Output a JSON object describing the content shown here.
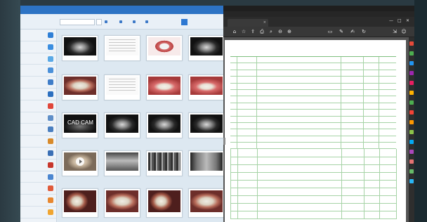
{
  "left_app": {
    "title": "",
    "toolbar": {
      "search_value": "",
      "field2_value": "",
      "buttons": [
        "",
        "",
        "",
        ""
      ],
      "blue_button_label": ""
    },
    "sidebar_items": [
      {
        "label": "",
        "color": "#2f7fd6"
      },
      {
        "label": "",
        "color": "#3b8ee0"
      },
      {
        "label": "",
        "color": "#5aa9e6"
      },
      {
        "label": "",
        "color": "#4a90d9"
      },
      {
        "label": "",
        "color": "#3f7dc8"
      },
      {
        "label": "",
        "color": "#2c6fbf"
      },
      {
        "label": "",
        "color": "#e0463a"
      },
      {
        "label": "",
        "color": "#5f8fc8"
      },
      {
        "label": "",
        "color": "#4a7fc0"
      },
      {
        "label": "",
        "color": "#d88a2a"
      },
      {
        "label": "",
        "color": "#3a6fb5"
      },
      {
        "label": "",
        "color": "#c7362c"
      },
      {
        "label": "",
        "color": "#4b86d0"
      },
      {
        "label": "",
        "color": "#e05a3a"
      },
      {
        "label": "",
        "color": "#e8872f"
      },
      {
        "label": "",
        "color": "#f0a530"
      }
    ],
    "thumbnails": {
      "captions": [
        "",
        "",
        "",
        "",
        "",
        "",
        "",
        "",
        "",
        "",
        "",
        "",
        "",
        "",
        "",
        "",
        "",
        "",
        "",
        ""
      ],
      "cadcam_text": "CAD CAM"
    }
  },
  "right_app": {
    "title": "",
    "menu_items": [
      "",
      "",
      "",
      "",
      "",
      "",
      "",
      ""
    ],
    "tab_label": "",
    "window_controls": [
      "—",
      "□",
      "✕"
    ],
    "pdf": {
      "header_items": [
        "",
        "",
        "",
        "",
        ""
      ],
      "rows": [
        {
          "c1": "",
          "c2": "",
          "c3": "",
          "c4": "",
          "c5": ""
        },
        {
          "c1": "",
          "c2": "",
          "c3": "",
          "c4": "",
          "c5": ""
        },
        {
          "c1": "",
          "c2": "",
          "c3": "",
          "c4": "",
          "c5": ""
        },
        {
          "c1": "",
          "c2": "",
          "c3": "",
          "c4": "",
          "c5": ""
        },
        {
          "c1": "",
          "c2": "",
          "c3": "",
          "c4": "",
          "c5": ""
        },
        {
          "c1": "",
          "c2": "",
          "c3": "",
          "c4": "",
          "c5": ""
        },
        {
          "c1": "",
          "c2": "",
          "c3": "",
          "c4": "",
          "c5": ""
        },
        {
          "c1": "",
          "c2": "",
          "c3": "",
          "c4": "",
          "c5": ""
        },
        {
          "c1": "",
          "c2": "",
          "c3": "",
          "c4": "",
          "c5": ""
        },
        {
          "c1": "",
          "c2": "",
          "c3": "",
          "c4": "",
          "c5": ""
        },
        {
          "c1": "",
          "c2": "",
          "c3": "",
          "c4": "",
          "c5": ""
        },
        {
          "c1": "",
          "c2": "",
          "c3": "",
          "c4": "",
          "c5": ""
        },
        {
          "c1": "",
          "c2": "",
          "c3": "",
          "c4": "",
          "c5": ""
        },
        {
          "c1": "",
          "c2": "",
          "c3": "",
          "c4": "",
          "c5": ""
        }
      ]
    },
    "rail_colors": [
      "#e64a3a",
      "#4caf50",
      "#2196f3",
      "#9c27b0",
      "#e91e63",
      "#ffb300",
      "#4caf50",
      "#f44336",
      "#ff9800",
      "#8bc34a",
      "#03a9f4",
      "#ab47bc",
      "#e57373",
      "#66bb6a",
      "#29b6f6"
    ]
  }
}
